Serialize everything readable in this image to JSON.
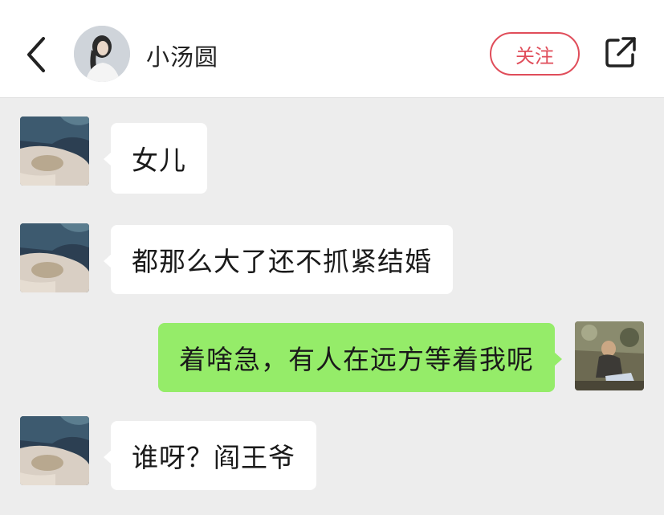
{
  "header": {
    "contact_name": "小汤圆",
    "follow_label": "关注"
  },
  "colors": {
    "follow_accent": "#e04d5a",
    "self_bubble": "#95ec69",
    "other_bubble": "#ffffff",
    "background": "#ededed"
  },
  "messages": [
    {
      "sender": "other",
      "text": "女儿"
    },
    {
      "sender": "other",
      "text": "都那么大了还不抓紧结婚"
    },
    {
      "sender": "self",
      "text": "着啥急，有人在远方等着我呢"
    },
    {
      "sender": "other",
      "text": "谁呀？阎王爷"
    }
  ],
  "icons": {
    "back": "chevron-left-icon",
    "share": "share-external-icon"
  }
}
